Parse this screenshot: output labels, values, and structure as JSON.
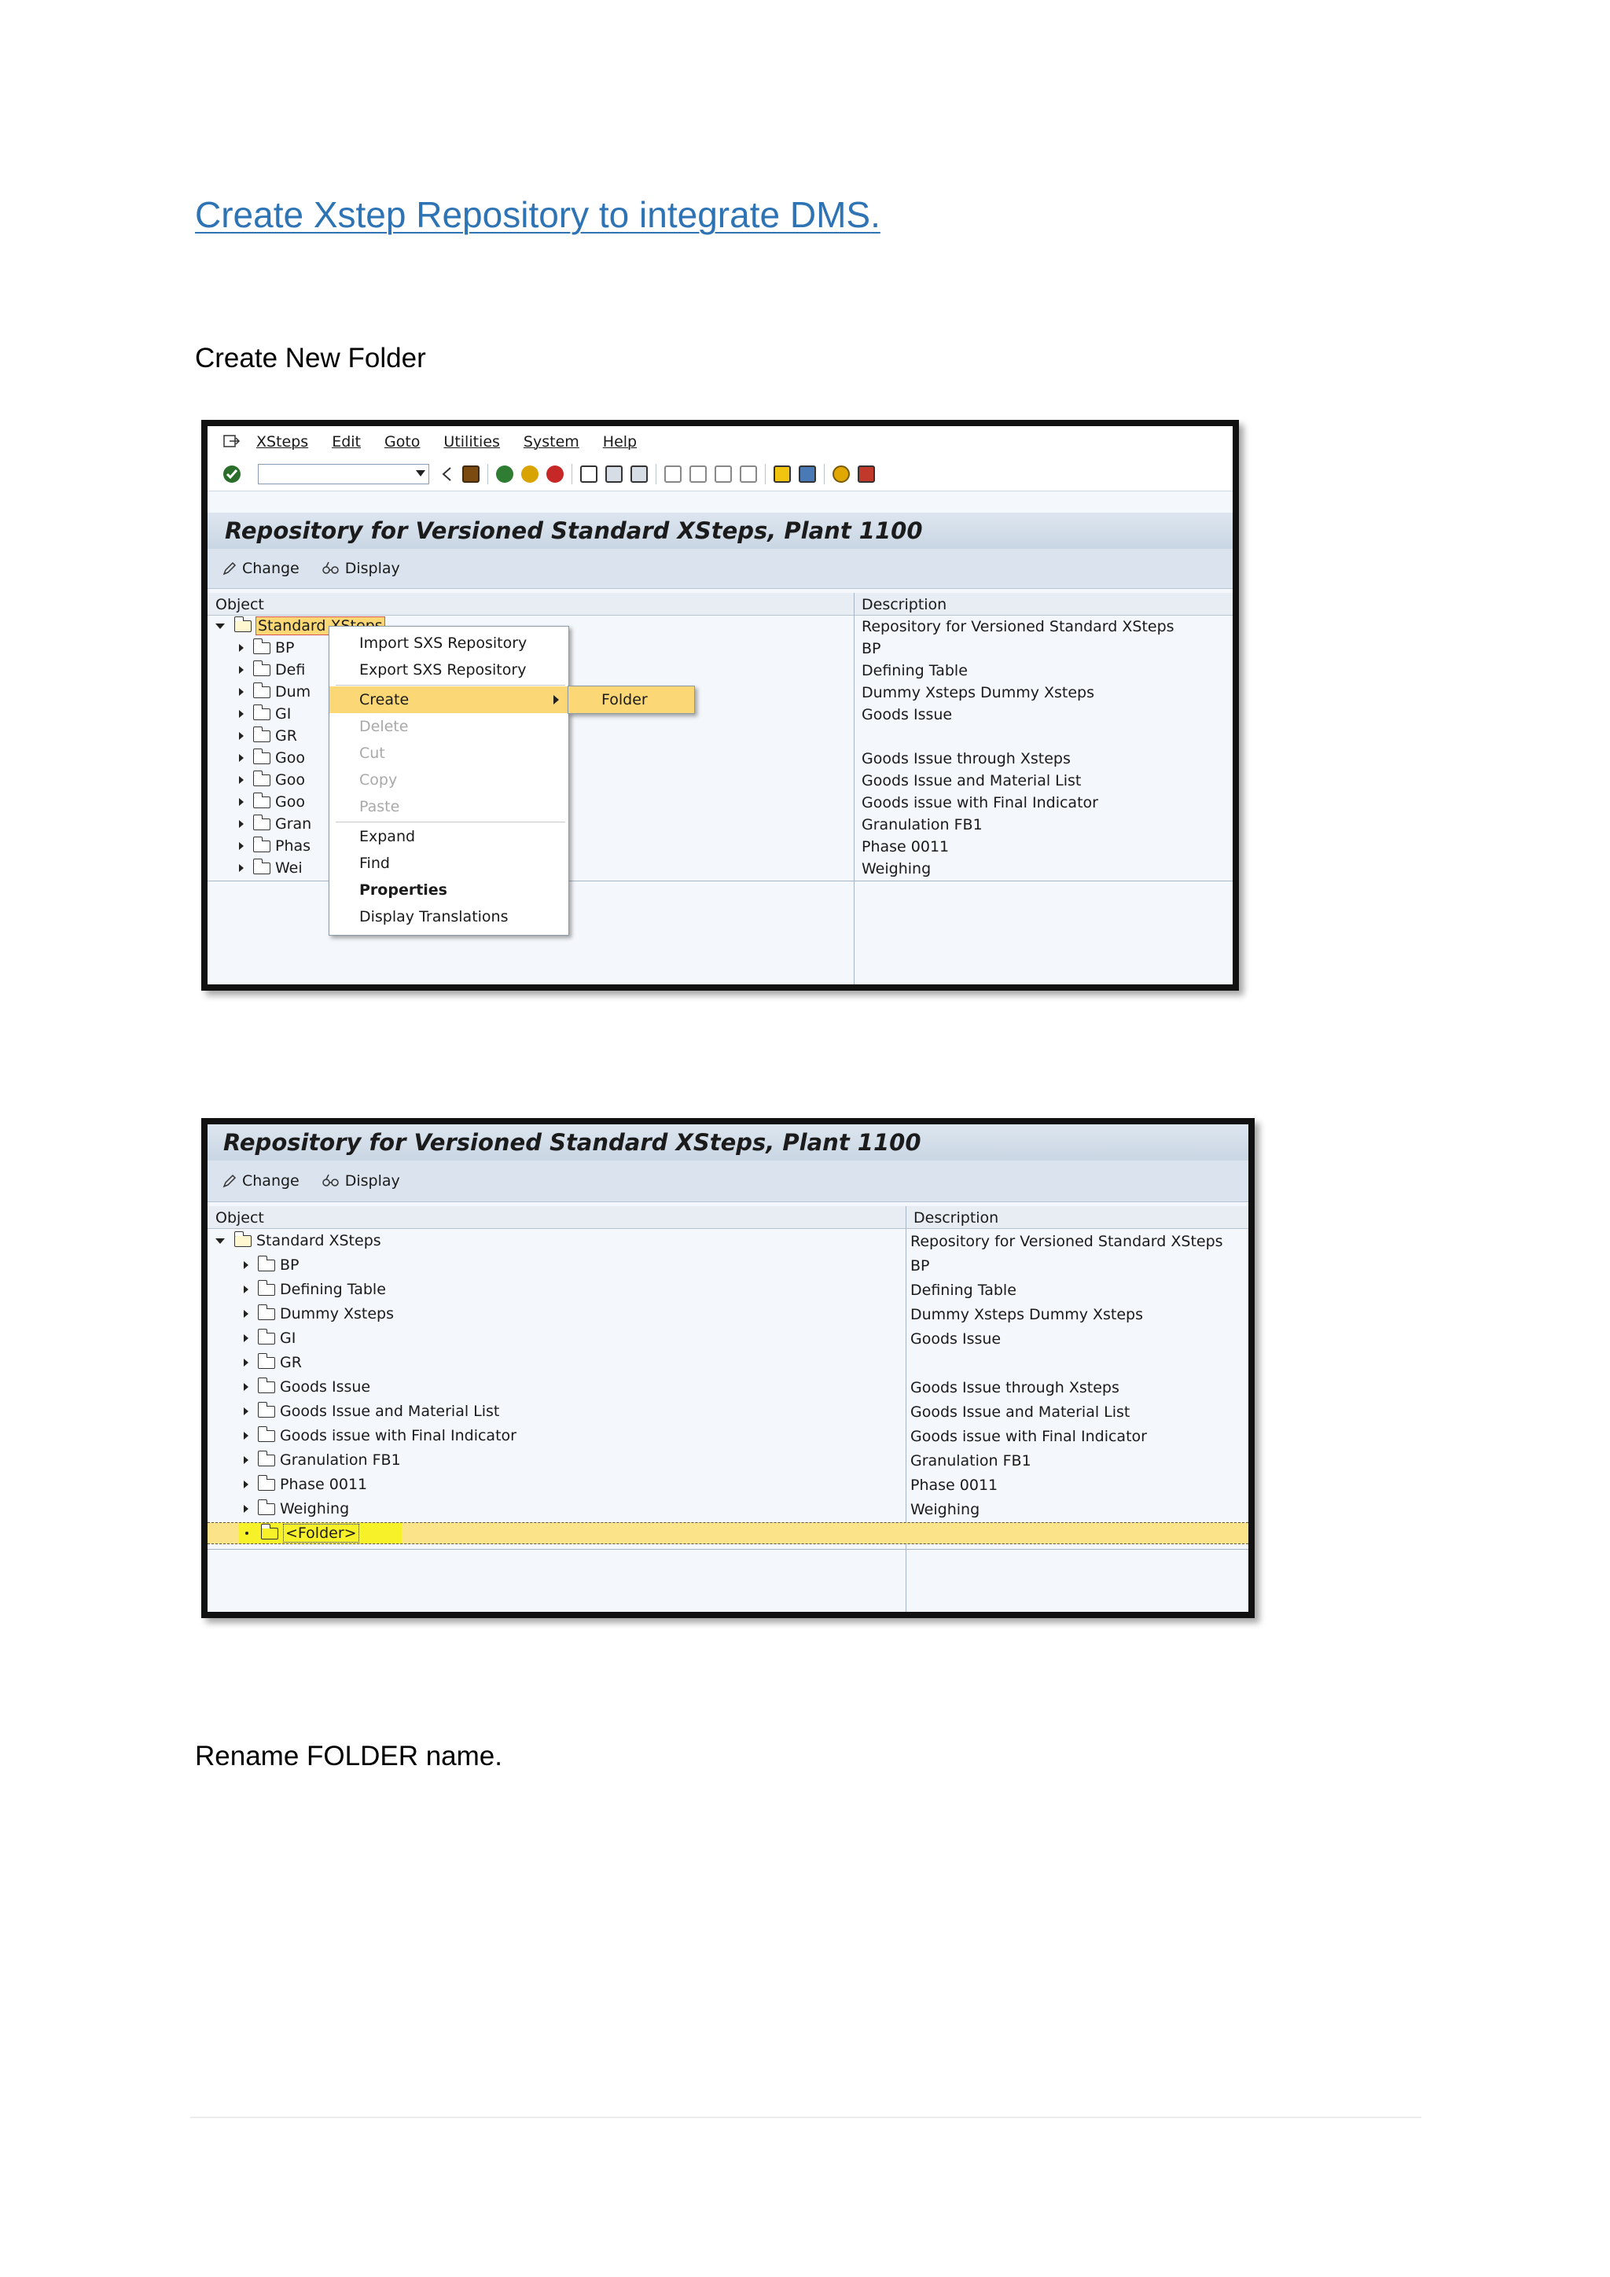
{
  "heading": {
    "text": "Create Xstep Repository to integrate DMS",
    "dot": "."
  },
  "para1": "Create New Folder",
  "para2": "Rename FOLDER name.",
  "menu": [
    "XSteps",
    "Edit",
    "Goto",
    "Utilities",
    "System",
    "Help"
  ],
  "screen_title": "Repository for Versioned Standard XSteps, Plant 1100",
  "buttons": {
    "change": "Change",
    "display": "Display"
  },
  "columns": {
    "object": "Object",
    "description": "Description"
  },
  "shot1": {
    "root_label": "Standard XSteps",
    "children": [
      "BP",
      "Defi",
      "Dum",
      "GI",
      "GR",
      "Goo",
      "Goo",
      "Goo",
      "Gran",
      "Phas",
      "Wei"
    ]
  },
  "tree": {
    "root": {
      "label": "Standard XSteps",
      "desc": "Repository for Versioned Standard XSteps"
    },
    "children": [
      {
        "label": "BP",
        "desc": "BP"
      },
      {
        "label": "Defining Table",
        "desc": "Defining Table"
      },
      {
        "label": "Dummy Xsteps",
        "desc": "Dummy Xsteps Dummy Xsteps"
      },
      {
        "label": "GI",
        "desc": "Goods Issue"
      },
      {
        "label": "GR",
        "desc": ""
      },
      {
        "label": "Goods Issue",
        "desc": "Goods Issue through Xsteps"
      },
      {
        "label": "Goods Issue and Material List",
        "desc": "Goods Issue and Material List"
      },
      {
        "label": "Goods issue with Final Indicator",
        "desc": "Goods issue with Final Indicator"
      },
      {
        "label": "Granulation FB1",
        "desc": "Granulation FB1"
      },
      {
        "label": "Phase 0011",
        "desc": "Phase 0011"
      },
      {
        "label": "Weighing",
        "desc": "Weighing"
      }
    ],
    "new_folder": "<Folder>"
  },
  "context_menu": {
    "items": [
      "Import SXS Repository",
      "Export SXS Repository",
      "Create",
      "Delete",
      "Cut",
      "Copy",
      "Paste",
      "Expand",
      "Find",
      "Properties",
      "Display Translations"
    ],
    "submenu": "Folder"
  }
}
